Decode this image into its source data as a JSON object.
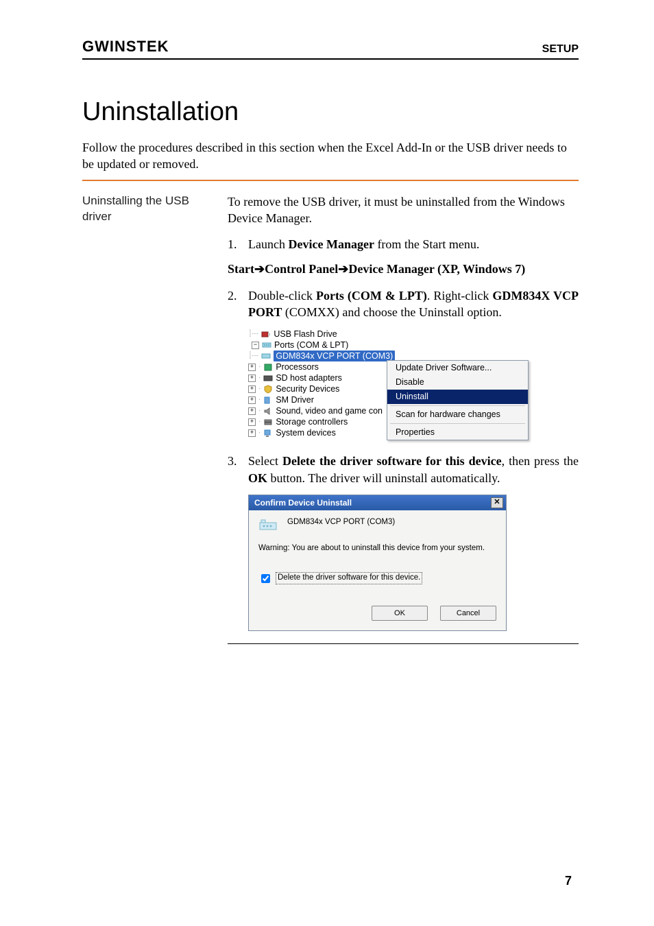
{
  "header": {
    "brand": "GWINSTEK",
    "right": "SETUP"
  },
  "title": "Uninstallation",
  "intro": "Follow the procedures described in this section when the Excel Add-In or the USB driver needs to be updated or removed.",
  "leftHeading": "Uninstalling the USB driver",
  "body": {
    "p0": "To remove the USB driver, it must be uninstalled from the Windows Device Manager.",
    "s1_num": "1.",
    "s1a": "Launch ",
    "s1b": "Device Manager",
    "s1c": " from the Start menu.",
    "s1path_start": "Start",
    "s1path_cp": "Control Panel",
    "s1path_dm": "Device Manager (XP, Windows 7)",
    "arrow": "➔",
    "s2_num": "2.",
    "s2a": "Double-click ",
    "s2b": "Ports (COM & LPT)",
    "s2c": ". Right-click ",
    "s2d": "GDM834X VCP PORT",
    "s2e": " (COMXX) and choose the Uninstall option.",
    "s3_num": "3.",
    "s3a": "Select ",
    "s3b": "Delete the driver software for this device",
    "s3c": ", then press the ",
    "s3d": "OK",
    "s3e": " button. The driver will uninstall automatically."
  },
  "tree": {
    "usbFlash": "USB Flash Drive",
    "ports": "Ports (COM & LPT)",
    "gdm": "GDM834x VCP PORT (COM3)",
    "processors": "Processors",
    "sdhost": "SD host adapters",
    "security": "Security Devices",
    "smdriver": "SM Driver",
    "sound": "Sound, video and game con",
    "storage": "Storage controllers",
    "system": "System devices"
  },
  "ctxmenu": {
    "update": "Update Driver Software...",
    "disable": "Disable",
    "uninstall": "Uninstall",
    "scan": "Scan for hardware changes",
    "properties": "Properties"
  },
  "dialog": {
    "title": "Confirm Device Uninstall",
    "device": "GDM834x VCP PORT (COM3)",
    "warn": "Warning: You are about to uninstall this device from your system.",
    "checkbox": "Delete the driver software for this device.",
    "ok": "OK",
    "cancel": "Cancel"
  },
  "pageNumber": "7"
}
